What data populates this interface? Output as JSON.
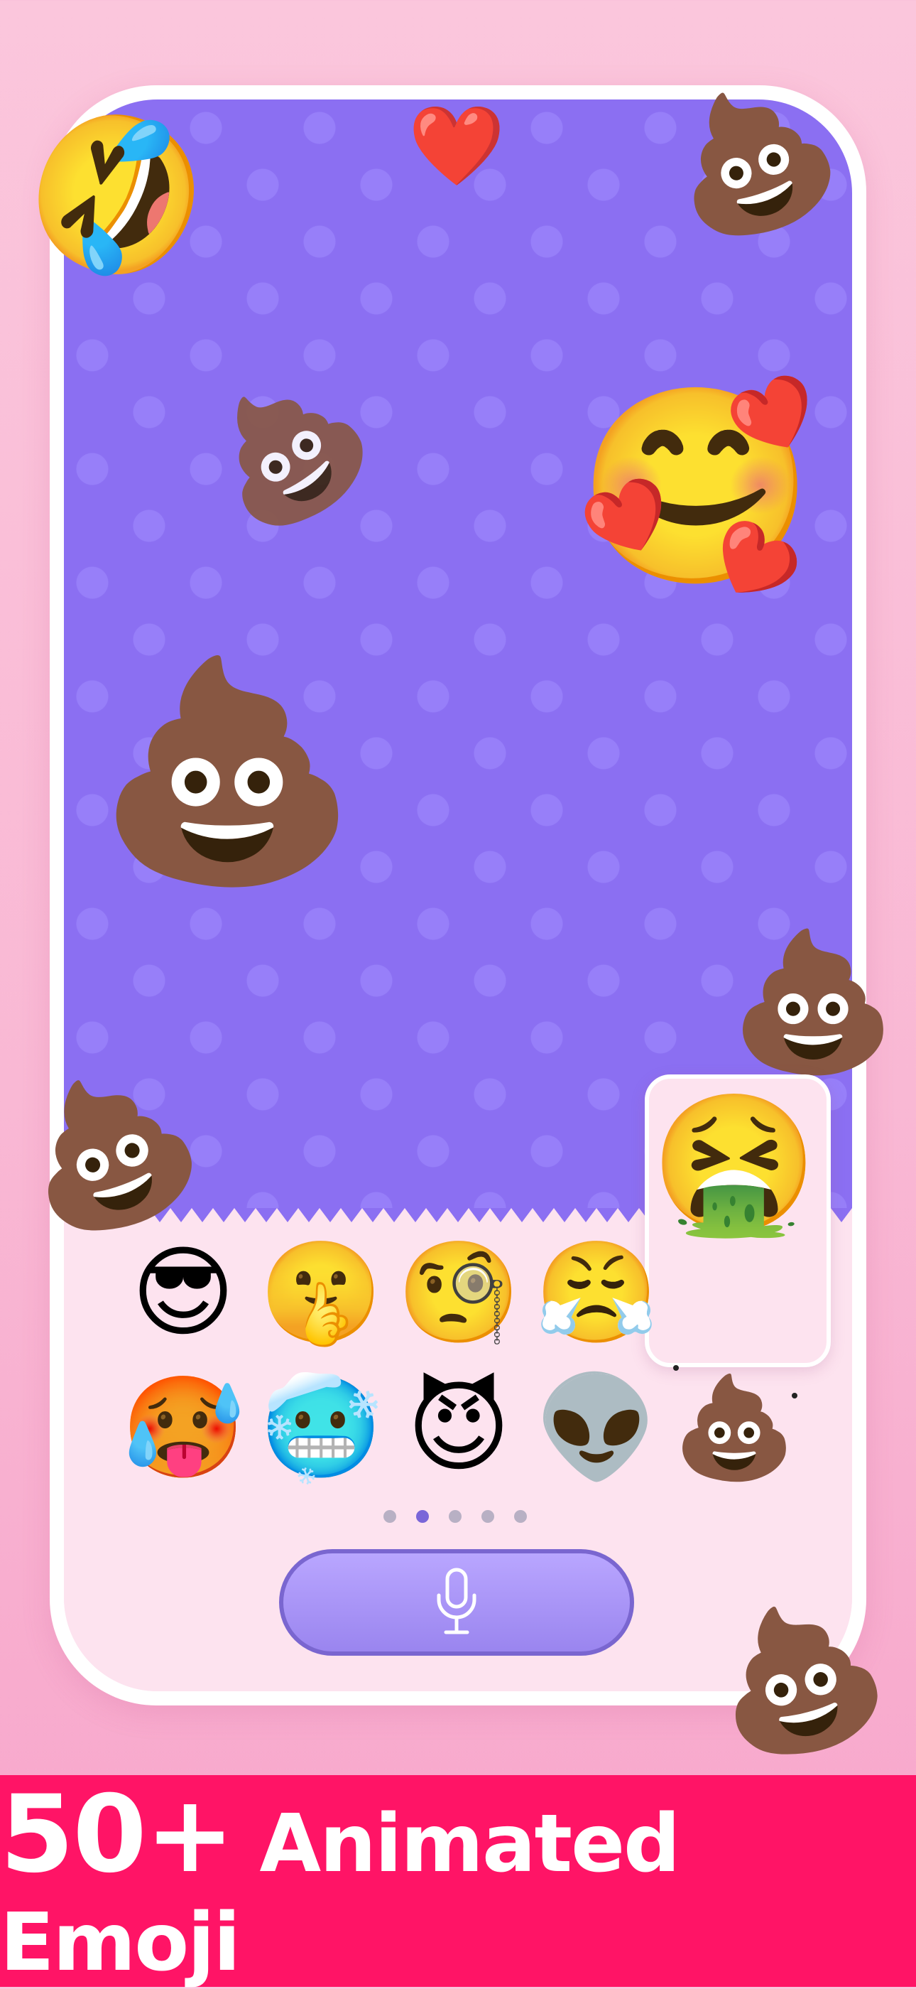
{
  "banner": {
    "text_big": "50+",
    "text_rest": "Animated Emoji"
  },
  "colors": {
    "screen_background": "#8b6ff2",
    "keyboard_background": "#fde3ef",
    "banner_background": "#ff1466",
    "mic_button": "#a893f5"
  },
  "floating_emoji": {
    "rolling_laughing": "🤣",
    "heart": "❤️",
    "poop_top_right": "💩",
    "poop_ghost": "💩",
    "smiling_hearts": "🥰",
    "poop_main": "💩",
    "poop_right": "💩",
    "poop_left": "💩",
    "poop_bottom_right": "💩"
  },
  "emoji_grid": {
    "row1": [
      "😎",
      "🤫",
      "🧐",
      "😤"
    ],
    "row2": [
      "🥵",
      "🥶",
      "😈",
      "👽",
      "💩"
    ]
  },
  "selected_emoji": "🤮",
  "pagination": {
    "total": 5,
    "active": 2
  },
  "mic_button": {
    "icon": "microphone-icon"
  }
}
